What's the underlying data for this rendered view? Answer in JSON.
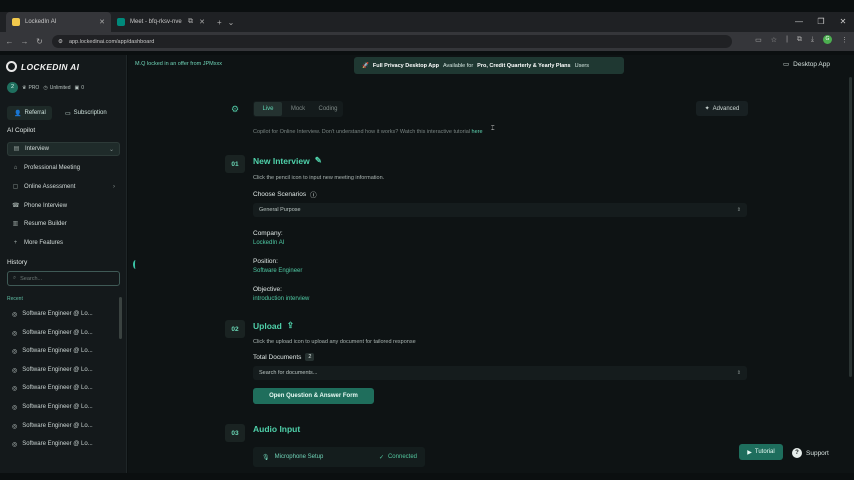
{
  "browser": {
    "tabs": [
      {
        "title": "LockedIn AI",
        "active": true
      },
      {
        "title": "Meet - bfq-rksv-nve",
        "active": false
      }
    ],
    "url": "app.lockedinai.com/app/dashboard",
    "profile_initial": "G"
  },
  "sidebar": {
    "logo_text": "LOCKEDIN AI",
    "logo_sub": "",
    "user_initial": "2",
    "plan_badge": "PRO",
    "unlimited_label": "Unlimited",
    "credits": "0",
    "referral_label": "Referral",
    "subscription_label": "Subscription",
    "copilot_section": "AI Copilot",
    "items": [
      {
        "label": "Interview",
        "icon": "interview-icon"
      },
      {
        "label": "Professional Meeting",
        "icon": "meeting-icon"
      },
      {
        "label": "Online Assessment",
        "icon": "assessment-icon"
      },
      {
        "label": "Phone Interview",
        "icon": "phone-icon"
      },
      {
        "label": "Resume Builder",
        "icon": "resume-icon"
      },
      {
        "label": "More Features",
        "icon": "plus-icon"
      }
    ],
    "history_section": "History",
    "search_placeholder": "Search...",
    "recent_label": "Recent",
    "history_items": [
      "Software Engineer @ Lo...",
      "Software Engineer @ Lo...",
      "Software Engineer @ Lo...",
      "Software Engineer @ Lo...",
      "Software Engineer @ Lo...",
      "Software Engineer @ Lo...",
      "Software Engineer @ Lo...",
      "Software Engineer @ Lo..."
    ]
  },
  "header": {
    "promo_text": "M.Q locked in an offer from JPMxxx",
    "banner_title": "Full Privacy Desktop App",
    "banner_mid": "Available for",
    "banner_plans": "Pro, Credit Quarterly & Yearly Plans",
    "banner_end": "Users",
    "desktop_app_label": "Desktop App"
  },
  "main": {
    "mode_tabs": [
      "Live",
      "Mock",
      "Coding"
    ],
    "active_mode": "Live",
    "advanced_label": "Advanced",
    "hint_text": "Copilot for Online Interview. Don't understand how it works? Watch this interactive tutorial",
    "hint_link": "here",
    "step1": {
      "num": "01",
      "title": "New Interview",
      "desc": "Click the pencil icon to input new meeting information.",
      "scenario_label": "Choose Scenarios",
      "scenario_value": "General Purpose",
      "company_label": "Company:",
      "company_value": "LockedIn AI",
      "position_label": "Position:",
      "position_value": "Software Engineer",
      "objective_label": "Objective:",
      "objective_value": "introduction interview"
    },
    "step2": {
      "num": "02",
      "title": "Upload",
      "desc": "Click the upload icon to upload any document for tailored response",
      "docs_label": "Total Documents",
      "docs_count": "2",
      "docs_search_placeholder": "Search for documents...",
      "qa_button": "Open Question & Answer Form"
    },
    "step3": {
      "num": "03",
      "title": "Audio Input",
      "mic_label": "Microphone Setup",
      "mic_status": "Connected"
    },
    "tutorial_label": "Tutorial",
    "support_label": "Support"
  }
}
